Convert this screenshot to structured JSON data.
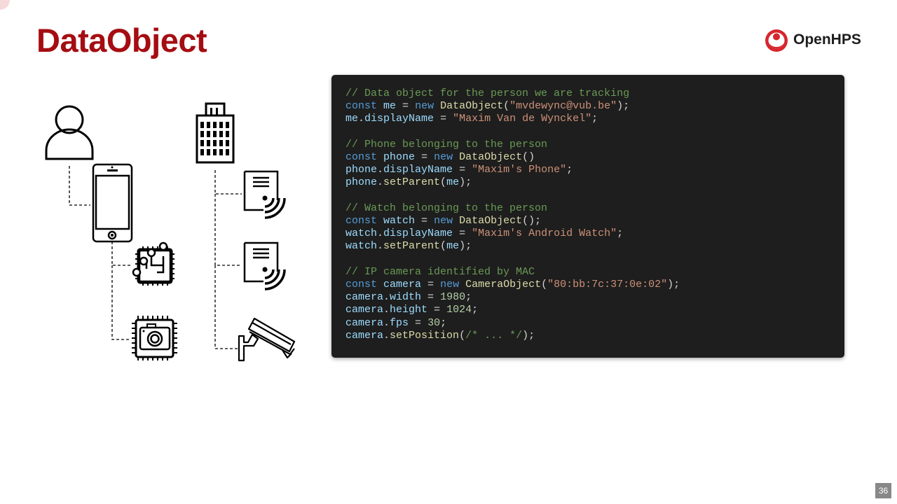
{
  "slide": {
    "title": "DataObject",
    "page_number": "36"
  },
  "logo": {
    "text": "OpenHPS",
    "icon": "openhps-location-pin-icon"
  },
  "colors": {
    "title": "#a50d12",
    "logo_red": "#d7262e",
    "code_background": "#1e1e1e",
    "comment": "#6a9955",
    "keyword": "#569cd6",
    "variable": "#9cdcfe",
    "function": "#dcdcaa",
    "string": "#ce9178",
    "number": "#b5cea8",
    "punctuation": "#d4d4d4"
  },
  "diagram": {
    "icons": [
      "person-icon",
      "building-icon",
      "smartphone-icon",
      "chip-icon",
      "camera-chip-icon",
      "wireless-document-icon",
      "wireless-document-icon",
      "security-camera-icon"
    ]
  },
  "code": {
    "lines": [
      [
        {
          "t": "// Data object for the person we are tracking",
          "k": "com"
        }
      ],
      [
        {
          "t": "const",
          "k": "kw"
        },
        {
          "t": " ",
          "k": "pun"
        },
        {
          "t": "me",
          "k": "var"
        },
        {
          "t": " = ",
          "k": "pun"
        },
        {
          "t": "new",
          "k": "kw"
        },
        {
          "t": " ",
          "k": "pun"
        },
        {
          "t": "DataObject",
          "k": "fn"
        },
        {
          "t": "(",
          "k": "pun"
        },
        {
          "t": "\"mvdewync@vub.be\"",
          "k": "str"
        },
        {
          "t": ");",
          "k": "pun"
        }
      ],
      [
        {
          "t": "me",
          "k": "var"
        },
        {
          "t": ".",
          "k": "pun"
        },
        {
          "t": "displayName",
          "k": "var"
        },
        {
          "t": " = ",
          "k": "pun"
        },
        {
          "t": "\"Maxim Van de Wynckel\"",
          "k": "str"
        },
        {
          "t": ";",
          "k": "pun"
        }
      ],
      [],
      [
        {
          "t": "// Phone belonging to the person",
          "k": "com"
        }
      ],
      [
        {
          "t": "const",
          "k": "kw"
        },
        {
          "t": " ",
          "k": "pun"
        },
        {
          "t": "phone",
          "k": "var"
        },
        {
          "t": " = ",
          "k": "pun"
        },
        {
          "t": "new",
          "k": "kw"
        },
        {
          "t": " ",
          "k": "pun"
        },
        {
          "t": "DataObject",
          "k": "fn"
        },
        {
          "t": "()",
          "k": "pun"
        }
      ],
      [
        {
          "t": "phone",
          "k": "var"
        },
        {
          "t": ".",
          "k": "pun"
        },
        {
          "t": "displayName",
          "k": "var"
        },
        {
          "t": " = ",
          "k": "pun"
        },
        {
          "t": "\"Maxim's Phone\"",
          "k": "str"
        },
        {
          "t": ";",
          "k": "pun"
        }
      ],
      [
        {
          "t": "phone",
          "k": "var"
        },
        {
          "t": ".",
          "k": "pun"
        },
        {
          "t": "setParent",
          "k": "fn"
        },
        {
          "t": "(",
          "k": "pun"
        },
        {
          "t": "me",
          "k": "var"
        },
        {
          "t": ");",
          "k": "pun"
        }
      ],
      [],
      [
        {
          "t": "// Watch belonging to the person",
          "k": "com"
        }
      ],
      [
        {
          "t": "const",
          "k": "kw"
        },
        {
          "t": " ",
          "k": "pun"
        },
        {
          "t": "watch",
          "k": "var"
        },
        {
          "t": " = ",
          "k": "pun"
        },
        {
          "t": "new",
          "k": "kw"
        },
        {
          "t": " ",
          "k": "pun"
        },
        {
          "t": "DataObject",
          "k": "fn"
        },
        {
          "t": "();",
          "k": "pun"
        }
      ],
      [
        {
          "t": "watch",
          "k": "var"
        },
        {
          "t": ".",
          "k": "pun"
        },
        {
          "t": "displayName",
          "k": "var"
        },
        {
          "t": " = ",
          "k": "pun"
        },
        {
          "t": "\"Maxim's Android Watch\"",
          "k": "str"
        },
        {
          "t": ";",
          "k": "pun"
        }
      ],
      [
        {
          "t": "watch",
          "k": "var"
        },
        {
          "t": ".",
          "k": "pun"
        },
        {
          "t": "setParent",
          "k": "fn"
        },
        {
          "t": "(",
          "k": "pun"
        },
        {
          "t": "me",
          "k": "var"
        },
        {
          "t": ");",
          "k": "pun"
        }
      ],
      [],
      [
        {
          "t": "// IP camera identified by MAC",
          "k": "com"
        }
      ],
      [
        {
          "t": "const",
          "k": "kw"
        },
        {
          "t": " ",
          "k": "pun"
        },
        {
          "t": "camera",
          "k": "var"
        },
        {
          "t": " = ",
          "k": "pun"
        },
        {
          "t": "new",
          "k": "kw"
        },
        {
          "t": " ",
          "k": "pun"
        },
        {
          "t": "CameraObject",
          "k": "fn"
        },
        {
          "t": "(",
          "k": "pun"
        },
        {
          "t": "\"80:bb:7c:37:0e:02\"",
          "k": "str"
        },
        {
          "t": ");",
          "k": "pun"
        }
      ],
      [
        {
          "t": "camera",
          "k": "var"
        },
        {
          "t": ".",
          "k": "pun"
        },
        {
          "t": "width",
          "k": "var"
        },
        {
          "t": " = ",
          "k": "pun"
        },
        {
          "t": "1980",
          "k": "num"
        },
        {
          "t": ";",
          "k": "pun"
        }
      ],
      [
        {
          "t": "camera",
          "k": "var"
        },
        {
          "t": ".",
          "k": "pun"
        },
        {
          "t": "height",
          "k": "var"
        },
        {
          "t": " = ",
          "k": "pun"
        },
        {
          "t": "1024",
          "k": "num"
        },
        {
          "t": ";",
          "k": "pun"
        }
      ],
      [
        {
          "t": "camera",
          "k": "var"
        },
        {
          "t": ".",
          "k": "pun"
        },
        {
          "t": "fps",
          "k": "var"
        },
        {
          "t": " = ",
          "k": "pun"
        },
        {
          "t": "30",
          "k": "num"
        },
        {
          "t": ";",
          "k": "pun"
        }
      ],
      [
        {
          "t": "camera",
          "k": "var"
        },
        {
          "t": ".",
          "k": "pun"
        },
        {
          "t": "setPosition",
          "k": "fn"
        },
        {
          "t": "(",
          "k": "pun"
        },
        {
          "t": "/* ... */",
          "k": "com"
        },
        {
          "t": ");",
          "k": "pun"
        }
      ]
    ]
  }
}
